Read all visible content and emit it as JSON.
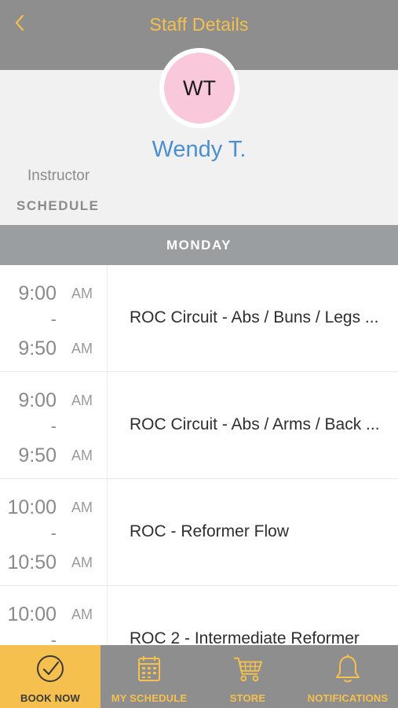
{
  "header": {
    "title": "Staff Details",
    "back_icon": "chevron-left-icon"
  },
  "colors": {
    "accent": "#f5c04d",
    "header_bg": "#8e8e8e",
    "name": "#4a8fd6",
    "avatar_bg": "#f9c9db",
    "day_bar": "#9a9ea1"
  },
  "staff": {
    "initials": "WT",
    "name": "Wendy T.",
    "role": "Instructor",
    "section_label": "SCHEDULE"
  },
  "schedule": {
    "day": "MONDAY",
    "dash": "-",
    "items": [
      {
        "start": "9:00",
        "start_ampm": "AM",
        "end": "9:50",
        "end_ampm": "AM",
        "name": "ROC Circuit - Abs / Buns / Legs ..."
      },
      {
        "start": "9:00",
        "start_ampm": "AM",
        "end": "9:50",
        "end_ampm": "AM",
        "name": "ROC Circuit - Abs / Arms / Back ..."
      },
      {
        "start": "10:00",
        "start_ampm": "AM",
        "end": "10:50",
        "end_ampm": "AM",
        "name": "ROC - Reformer Flow"
      },
      {
        "start": "10:00",
        "start_ampm": "AM",
        "end": "",
        "end_ampm": "",
        "name": "ROC 2 - Intermediate Reformer"
      }
    ]
  },
  "tabs": [
    {
      "label": "BOOK NOW",
      "icon": "check-circle-icon",
      "active": true
    },
    {
      "label": "MY SCHEDULE",
      "icon": "calendar-icon",
      "active": false
    },
    {
      "label": "STORE",
      "icon": "cart-icon",
      "active": false
    },
    {
      "label": "NOTIFICATIONS",
      "icon": "bell-icon",
      "active": false
    }
  ]
}
